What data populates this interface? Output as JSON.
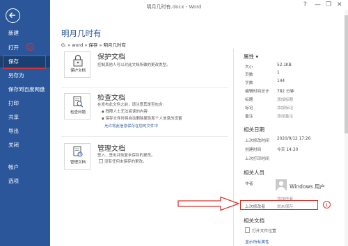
{
  "window": {
    "title": "明月几时有.docx - Word",
    "help": "?",
    "minimize": "—",
    "restore": "❐",
    "close": "✕"
  },
  "sidebar": {
    "items": [
      {
        "label": "新建"
      },
      {
        "label": "打开"
      },
      {
        "label": "保存"
      },
      {
        "label": "另存为"
      },
      {
        "label": "保存到百度网盘"
      },
      {
        "label": "打印"
      },
      {
        "label": "共享"
      },
      {
        "label": "导出"
      },
      {
        "label": "关闭"
      },
      {
        "label": "帐户"
      },
      {
        "label": "选项"
      }
    ],
    "annotation_2": "2"
  },
  "main": {
    "title": "明月几时有",
    "breadcrumb": "G: » word » 保存 » 明月几时有",
    "sections": [
      {
        "card_label": "保护文档",
        "title": "保护文档",
        "lines": [
          "控制其他人可以对此文档所做的更改类型。"
        ]
      },
      {
        "card_label": "检查问题",
        "title": "检查文档",
        "lines": [
          "在发布此文件之前，请注意其是否包含:",
          "▪  残障人士无法阅读的内容",
          "▪  保存文件时将自动删除属性和个人信息的设置"
        ],
        "link": "允许将此信息保存在您的文件中"
      },
      {
        "card_label": "管理文档",
        "title": "管理文档",
        "lines": [
          "签入、签出并恢复未保存的更改。",
          "没有任何未保存的更改。"
        ]
      }
    ]
  },
  "properties": {
    "header": "属性 ▾",
    "items": [
      {
        "label": "大小",
        "value": "52.1KB",
        "muted": false
      },
      {
        "label": "页数",
        "value": "1",
        "muted": false
      },
      {
        "label": "字数",
        "value": "144",
        "muted": false
      },
      {
        "label": "编辑时间总计",
        "value": "782 分钟",
        "muted": false
      },
      {
        "label": "标题",
        "value": "添加标题",
        "muted": true
      },
      {
        "label": "标记",
        "value": "添加标记",
        "muted": true
      },
      {
        "label": "备注",
        "value": "添加备注",
        "muted": true
      }
    ],
    "related_dates_header": "相关日期",
    "dates": [
      {
        "label": "上次修改时间",
        "value": "2020/9/12 17:26"
      },
      {
        "label": "创建时间",
        "value": "今天 14:30"
      },
      {
        "label": "上次打印时间",
        "value": ""
      }
    ],
    "related_people_header": "相关人员",
    "author_label": "作者",
    "author_name": "Windows 用户",
    "add_author": "添加作者",
    "last_modified_by_label": "上次修改者",
    "last_modified_by_value": "尚未保存",
    "annotation_1": "1",
    "related_docs_header": "相关文档",
    "open_location": "打开文件位置",
    "show_all": "显示所有属性"
  },
  "colors": {
    "accent": "#2b579a",
    "annotation": "#e0312b",
    "sidebar_active": "#1a3f73"
  }
}
